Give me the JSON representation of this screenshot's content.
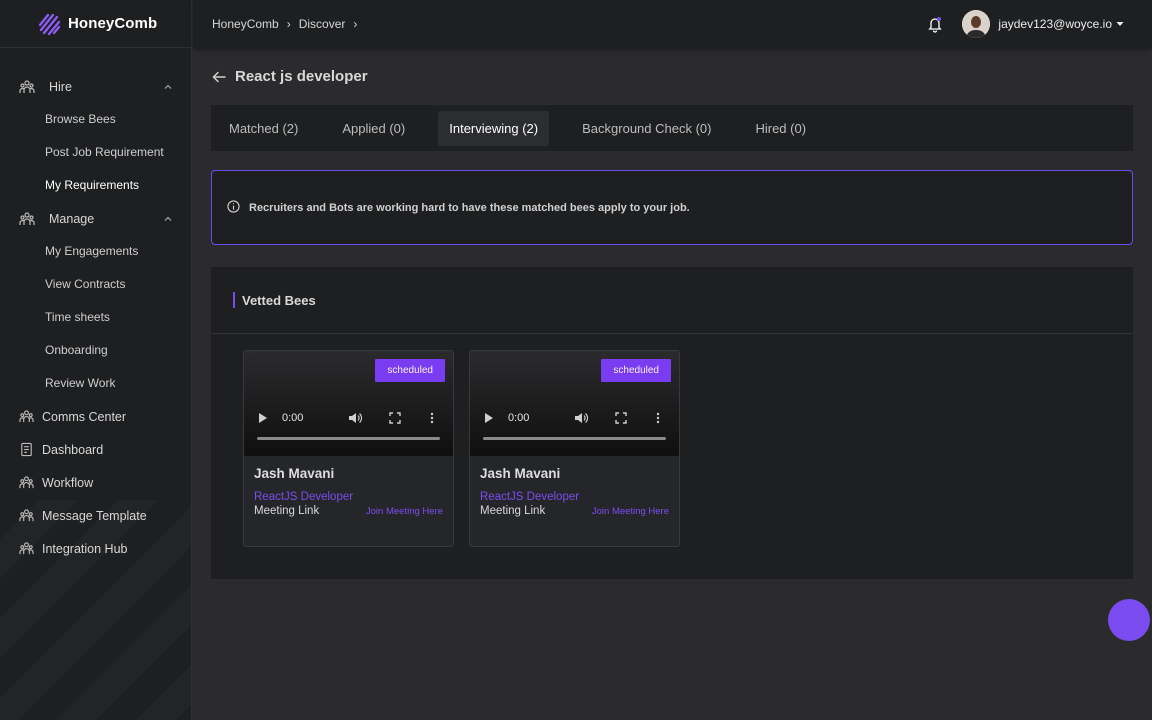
{
  "brand": {
    "name": "HoneyComb"
  },
  "sidebar": {
    "hire": {
      "label": "Hire",
      "items": [
        {
          "label": "Browse Bees"
        },
        {
          "label": "Post Job Requirement"
        },
        {
          "label": "My Requirements"
        }
      ]
    },
    "manage": {
      "label": "Manage",
      "items": [
        {
          "label": "My Engagements"
        },
        {
          "label": "View Contracts"
        },
        {
          "label": "Time sheets"
        },
        {
          "label": "Onboarding"
        },
        {
          "label": "Review Work"
        }
      ]
    },
    "items": [
      {
        "label": "Comms Center"
      },
      {
        "label": "Dashboard"
      },
      {
        "label": "Workflow"
      },
      {
        "label": "Message Template"
      },
      {
        "label": "Integration Hub"
      }
    ]
  },
  "header": {
    "breadcrumb": [
      "HoneyComb",
      "Discover"
    ],
    "user_email": "jaydev123@woyce.io"
  },
  "page": {
    "title": "React js developer"
  },
  "tabs": [
    {
      "label": "Matched (2)"
    },
    {
      "label": "Applied (0)"
    },
    {
      "label": "Interviewing (2)"
    },
    {
      "label": "Background Check (0)"
    },
    {
      "label": "Hired (0)"
    }
  ],
  "alert": {
    "text": "Recruiters and Bots are working hard to have these matched bees apply to your job."
  },
  "panel": {
    "title": "Vetted Bees"
  },
  "cards": [
    {
      "status": "scheduled",
      "time": "0:00",
      "name": "Jash Mavani",
      "role": "ReactJS Developer",
      "meeting_label": "Meeting Link",
      "meeting_link": "Join Meeting Here"
    },
    {
      "status": "scheduled",
      "time": "0:00",
      "name": "Jash Mavani",
      "role": "ReactJS Developer",
      "meeting_label": "Meeting Link",
      "meeting_link": "Join Meeting Here"
    }
  ],
  "colors": {
    "accent": "#7a4cf0",
    "sidebar_bg": "#1e1f21",
    "page_bg": "#2b2b2e"
  }
}
